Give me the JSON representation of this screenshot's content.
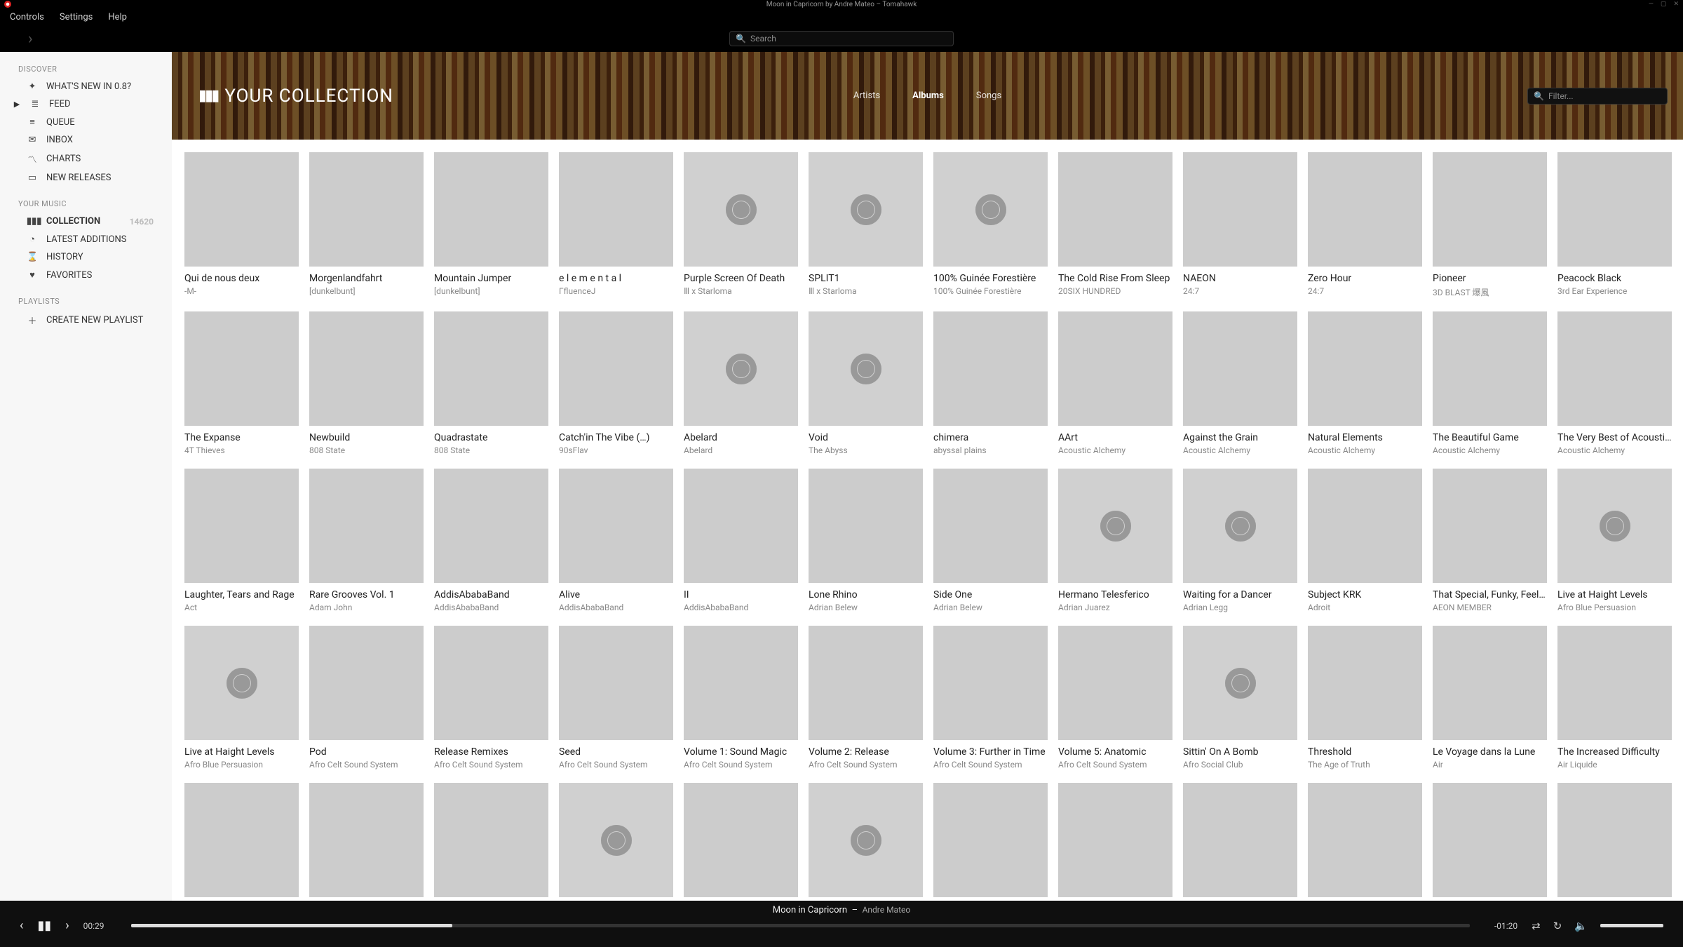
{
  "window": {
    "title": "Moon in Capricorn by Andre Mateo – Tomahawk"
  },
  "menubar": [
    "Controls",
    "Settings",
    "Help"
  ],
  "global_search_placeholder": "Search",
  "sidebar": {
    "sections": {
      "discover": "DISCOVER",
      "your_music": "YOUR MUSIC",
      "playlists": "PLAYLISTS"
    },
    "discover": [
      {
        "icon": "✦",
        "label": "WHAT'S NEW IN 0.8?"
      },
      {
        "icon": "≣",
        "label": "FEED",
        "indicator": "▶"
      },
      {
        "icon": "≡",
        "label": "QUEUE"
      },
      {
        "icon": "✉",
        "label": "INBOX"
      },
      {
        "icon": "〽",
        "label": "CHARTS"
      },
      {
        "icon": "▭",
        "label": "NEW RELEASES"
      }
    ],
    "your_music": [
      {
        "icon": "▮▮▮",
        "label": "COLLECTION",
        "active": true,
        "count": "14620"
      },
      {
        "icon": "◔",
        "label": "LATEST ADDITIONS"
      },
      {
        "icon": "⌛",
        "label": "HISTORY"
      },
      {
        "icon": "♥",
        "label": "FAVORITES"
      }
    ],
    "create_playlist": "CREATE NEW PLAYLIST"
  },
  "header": {
    "title": "YOUR COLLECTION",
    "tabs": [
      "Artists",
      "Albums",
      "Songs"
    ],
    "active_tab": "Albums",
    "filter_placeholder": "Filter..."
  },
  "albums": [
    {
      "title": "Qui de nous deux",
      "artist": "-M-",
      "cover": "cov-a"
    },
    {
      "title": "Morgenlandfahrt",
      "artist": "[dunkelbunt]",
      "cover": "cov-b"
    },
    {
      "title": "Mountain Jumper",
      "artist": "[dunkelbunt]",
      "cover": "cov-c"
    },
    {
      "title": "e l e m e n t a l",
      "artist": "ΓfluenceJ",
      "cover": "cov-d"
    },
    {
      "title": "Purple Screen Of Death",
      "artist": "Ⅲ x Starloma",
      "cover": "placeholder"
    },
    {
      "title": "SPLIT1",
      "artist": "Ⅲ x Starloma",
      "cover": "placeholder"
    },
    {
      "title": "100% Guinée Forestière",
      "artist": "100% Guinée Forestière",
      "cover": "placeholder"
    },
    {
      "title": "The Cold Rise From Sleep",
      "artist": "20SIX HUNDRED",
      "cover": "cov-e"
    },
    {
      "title": "NAEON",
      "artist": "24:7",
      "cover": "cov-f"
    },
    {
      "title": "Zero Hour",
      "artist": "24:7",
      "cover": "cov-g"
    },
    {
      "title": "Pioneer",
      "artist": "3D BLAST 爆風",
      "cover": "cov-h"
    },
    {
      "title": "Peacock Black",
      "artist": "3rd Ear Experience",
      "cover": "cov-i"
    },
    {
      "title": "The Expanse",
      "artist": "4T Thieves",
      "cover": "cov-j"
    },
    {
      "title": "Newbuild",
      "artist": "808 State",
      "cover": "cov-k"
    },
    {
      "title": "Quadrastate",
      "artist": "808 State",
      "cover": "cov-l"
    },
    {
      "title": "Catch'in The Vibe (…)",
      "artist": "90sFlav",
      "cover": "cov-m"
    },
    {
      "title": "Abelard",
      "artist": "Abelard",
      "cover": "placeholder"
    },
    {
      "title": "Void",
      "artist": "The Abyss",
      "cover": "placeholder"
    },
    {
      "title": "chimera",
      "artist": "abyssal plains",
      "cover": "cov-n"
    },
    {
      "title": "AArt",
      "artist": "Acoustic Alchemy",
      "cover": "cov-s"
    },
    {
      "title": "Against the Grain",
      "artist": "Acoustic Alchemy",
      "cover": "cov-p"
    },
    {
      "title": "Natural Elements",
      "artist": "Acoustic Alchemy",
      "cover": "cov-s"
    },
    {
      "title": "The Beautiful Game",
      "artist": "Acoustic Alchemy",
      "cover": "cov-r"
    },
    {
      "title": "The Very Best of Acoustic Alchemy",
      "artist": "Acoustic Alchemy",
      "cover": "cov-q"
    },
    {
      "title": "Laughter, Tears and Rage",
      "artist": "Act",
      "cover": "cov-p"
    },
    {
      "title": "Rare Grooves Vol. 1",
      "artist": "Adam John",
      "cover": "cov-r"
    },
    {
      "title": "AddisAbabaBand",
      "artist": "AddisAbabaBand",
      "cover": "cov-o"
    },
    {
      "title": "Alive",
      "artist": "AddisAbabaBand",
      "cover": "cov-q"
    },
    {
      "title": "II",
      "artist": "AddisAbabaBand",
      "cover": "cov-h"
    },
    {
      "title": "Lone Rhino",
      "artist": "Adrian Belew",
      "cover": "cov-c"
    },
    {
      "title": "Side One",
      "artist": "Adrian Belew",
      "cover": "cov-n"
    },
    {
      "title": "Hermano Telesferico",
      "artist": "Adrian Juarez",
      "cover": "placeholder"
    },
    {
      "title": "Waiting for a Dancer",
      "artist": "Adrian Legg",
      "cover": "placeholder"
    },
    {
      "title": "Subject KRK",
      "artist": "Adroit",
      "cover": "cov-q"
    },
    {
      "title": "That Special, Funky, Feeling",
      "artist": "AEON MEMBER",
      "cover": "cov-s"
    },
    {
      "title": "Live at Haight Levels",
      "artist": "Afro Blue Persuasion",
      "cover": "placeholder"
    },
    {
      "title": "Live at Haight Levels",
      "artist": "Afro Blue Persuasion",
      "cover": "placeholder"
    },
    {
      "title": "Pod",
      "artist": "Afro Celt Sound System",
      "cover": "cov-r"
    },
    {
      "title": "Release Remixes",
      "artist": "Afro Celt Sound System",
      "cover": "cov-o"
    },
    {
      "title": "Seed",
      "artist": "Afro Celt Sound System",
      "cover": "cov-s"
    },
    {
      "title": "Volume 1: Sound Magic",
      "artist": "Afro Celt Sound System",
      "cover": "cov-p"
    },
    {
      "title": "Volume 2: Release",
      "artist": "Afro Celt Sound System",
      "cover": "cov-k"
    },
    {
      "title": "Volume 3: Further in Time",
      "artist": "Afro Celt Sound System",
      "cover": "cov-o"
    },
    {
      "title": "Volume 5: Anatomic",
      "artist": "Afro Celt Sound System",
      "cover": "cov-s"
    },
    {
      "title": "Sittin' On A Bomb",
      "artist": "Afro Social Club",
      "cover": "placeholder"
    },
    {
      "title": "Threshold",
      "artist": "The Age of Truth",
      "cover": "cov-r"
    },
    {
      "title": "Le Voyage dans la Lune",
      "artist": "Air",
      "cover": "cov-q"
    },
    {
      "title": "The Increased Difficulty",
      "artist": "Air Liquide",
      "cover": "cov-s"
    },
    {
      "title": "",
      "artist": "",
      "cover": "cov-c"
    },
    {
      "title": "",
      "artist": "",
      "cover": "cov-n"
    },
    {
      "title": "",
      "artist": "",
      "cover": "cov-o"
    },
    {
      "title": "",
      "artist": "",
      "cover": "placeholder"
    },
    {
      "title": "",
      "artist": "",
      "cover": "cov-p"
    },
    {
      "title": "",
      "artist": "",
      "cover": "placeholder"
    },
    {
      "title": "",
      "artist": "",
      "cover": "cov-r"
    },
    {
      "title": "",
      "artist": "",
      "cover": "cov-q"
    },
    {
      "title": "",
      "artist": "",
      "cover": "cov-i"
    },
    {
      "title": "",
      "artist": "",
      "cover": "cov-e"
    },
    {
      "title": "",
      "artist": "",
      "cover": "cov-m"
    },
    {
      "title": "",
      "artist": "",
      "cover": "cov-l"
    }
  ],
  "player": {
    "track": "Moon in Capricorn",
    "artist": "Andre Mateo",
    "elapsed": "00:29",
    "remaining": "-01:20",
    "separator": "–"
  }
}
